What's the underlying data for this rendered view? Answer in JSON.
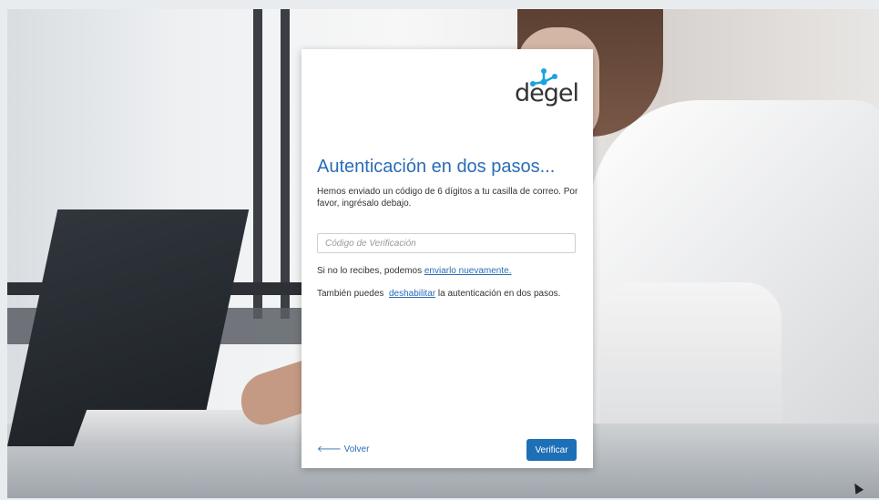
{
  "brand": {
    "name": "degel",
    "accent": "#1d6fb8",
    "logo_icon_color": "#1aa3e0"
  },
  "card": {
    "title": "Autenticación en dos pasos...",
    "description": "Hemos enviado un código de 6 dígitos a tu casilla de correo. Por favor, ingrésalo debajo.",
    "code_input": {
      "placeholder": "Código de Verificación",
      "value": ""
    },
    "resend": {
      "prefix": "Si no lo recibes, podemos ",
      "link_text": "enviarlo nuevamente."
    },
    "disable": {
      "prefix": "También puedes ",
      "link_text": "deshabilitar",
      "suffix": " la autenticación en dos pasos."
    },
    "back_label": "Volver",
    "back_icon": "arrow-left-icon",
    "verify_label": "Verificar"
  }
}
